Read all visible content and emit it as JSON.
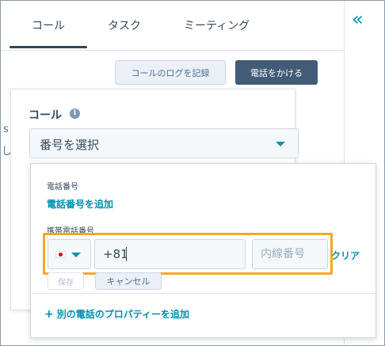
{
  "tabs": [
    {
      "label": "コール"
    },
    {
      "label": "タスク"
    },
    {
      "label": "ミーティング"
    }
  ],
  "active_tab": "コール",
  "actions": {
    "log_call_label": "コールのログを記録",
    "make_call_label": "電話をかける"
  },
  "call_section": {
    "label": "コール",
    "select_value": "番号を選択",
    "clipped_left": [
      "s",
      "し"
    ]
  },
  "dropdown": {
    "phone_label": "電話番号",
    "add_phone_link": "電話番号を追加",
    "mobile_label": "携帯電話番号",
    "country_code_value": "+81",
    "extension_placeholder": "内線番号",
    "clear_label": "クリア",
    "save_label": "保存",
    "cancel_label": "キャンセル",
    "add_property_label": "別の電話のプロパティーを追加"
  },
  "icons": {
    "collapse": "double-chevron-left-icon",
    "info": "info-icon",
    "flag": "japan-flag-icon",
    "plus": "plus-icon"
  },
  "colors": {
    "accent": "#0091ae",
    "primary_button": "#425b76",
    "highlight": "#f5a623"
  }
}
